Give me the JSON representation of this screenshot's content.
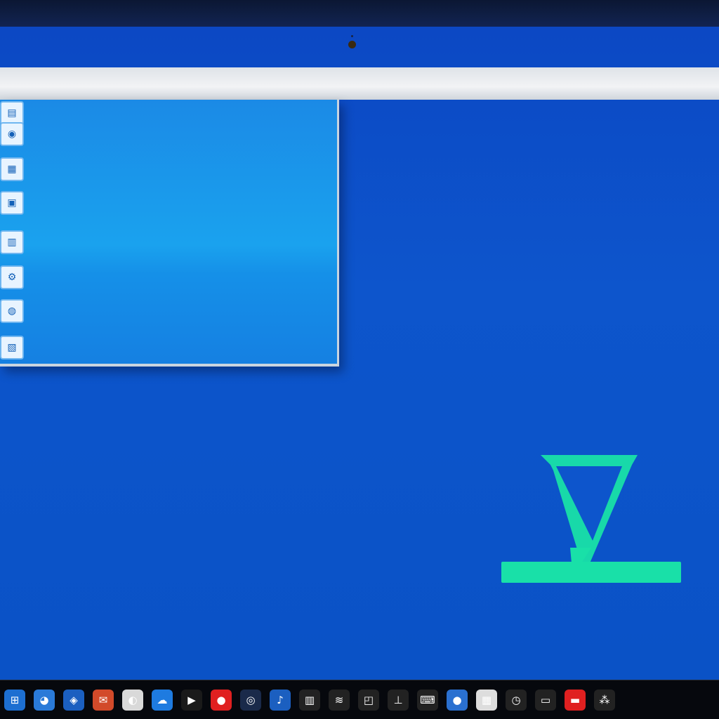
{
  "panel": {
    "items": [
      {
        "icon": "document-icon",
        "glyph": "▤",
        "line1": "",
        "line2": ""
      },
      {
        "icon": "disc-icon",
        "glyph": "◉",
        "line1": "",
        "line2": ""
      },
      {
        "icon": "folder-icon",
        "glyph": "▦",
        "line1": "",
        "line2": ""
      },
      {
        "icon": "app-icon",
        "glyph": "▣",
        "line1": "",
        "line2": ""
      },
      {
        "icon": "grid-icon",
        "glyph": "▥",
        "line1": "",
        "line2": ""
      },
      {
        "icon": "settings-icon",
        "glyph": "⚙",
        "line1": "",
        "line2": ""
      },
      {
        "icon": "globe-icon",
        "glyph": "◍",
        "line1": "",
        "line2": ""
      },
      {
        "icon": "archive-icon",
        "glyph": "▧",
        "line1": "",
        "line2": ""
      }
    ]
  },
  "logo": {
    "name": "hourglass-logo-icon",
    "color": "#19e0a8"
  },
  "taskbar": {
    "icons": [
      {
        "name": "windows-icon",
        "glyph": "⊞",
        "bg": "#1d6fd1"
      },
      {
        "name": "browser-icon",
        "glyph": "◕",
        "bg": "#2a7ad8"
      },
      {
        "name": "explorer-icon",
        "glyph": "◈",
        "bg": "#1b5fc0"
      },
      {
        "name": "mail-icon",
        "glyph": "✉",
        "bg": "#d24a2a"
      },
      {
        "name": "photos-icon",
        "glyph": "◐",
        "bg": "#d9d9d9"
      },
      {
        "name": "cloud-icon",
        "glyph": "☁",
        "bg": "#1e7be0"
      },
      {
        "name": "terminal-icon",
        "glyph": "▶",
        "bg": "#1a1a1a"
      },
      {
        "name": "record-icon",
        "glyph": "●",
        "bg": "#e02020"
      },
      {
        "name": "camera-icon",
        "glyph": "◎",
        "bg": "#1a2a4a"
      },
      {
        "name": "media-icon",
        "glyph": "♪",
        "bg": "#1b5fc0"
      },
      {
        "name": "chart-icon",
        "glyph": "▥",
        "bg": "#222"
      },
      {
        "name": "signal-icon",
        "glyph": "≋",
        "bg": "#222"
      },
      {
        "name": "bag-icon",
        "glyph": "◰",
        "bg": "#222"
      },
      {
        "name": "network-icon",
        "glyph": "⊥",
        "bg": "#222"
      },
      {
        "name": "keyboard-icon",
        "glyph": "⌨",
        "bg": "#222"
      },
      {
        "name": "weather-icon",
        "glyph": "●",
        "bg": "#2a70d0"
      },
      {
        "name": "calendar-icon",
        "glyph": "▦",
        "bg": "#ddd"
      },
      {
        "name": "clock-icon",
        "glyph": "◷",
        "bg": "#222"
      },
      {
        "name": "display-icon",
        "glyph": "▭",
        "bg": "#222"
      },
      {
        "name": "notification-icon",
        "glyph": "▬",
        "bg": "#e02020"
      },
      {
        "name": "language-icon",
        "glyph": "⁂",
        "bg": "#222"
      }
    ]
  }
}
